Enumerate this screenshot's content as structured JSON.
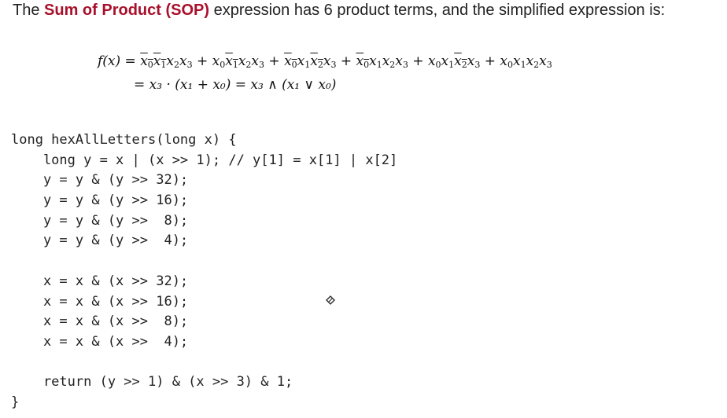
{
  "intro": {
    "before": "The ",
    "highlight": "Sum of Product (SOP)",
    "after": " expression has 6 product terms, and the simplified expression is:"
  },
  "formula": {
    "lhs": "f(x) = ",
    "terms": [
      [
        {
          "v": "x",
          "s": "0",
          "bar": true
        },
        {
          "v": "x",
          "s": "1",
          "bar": true
        },
        {
          "v": "x",
          "s": "2",
          "bar": false
        },
        {
          "v": "x",
          "s": "3",
          "bar": false
        }
      ],
      [
        {
          "v": "x",
          "s": "0",
          "bar": false
        },
        {
          "v": "x",
          "s": "1",
          "bar": true
        },
        {
          "v": "x",
          "s": "2",
          "bar": false
        },
        {
          "v": "x",
          "s": "3",
          "bar": false
        }
      ],
      [
        {
          "v": "x",
          "s": "0",
          "bar": true
        },
        {
          "v": "x",
          "s": "1",
          "bar": false
        },
        {
          "v": "x",
          "s": "2",
          "bar": true
        },
        {
          "v": "x",
          "s": "3",
          "bar": false
        }
      ],
      [
        {
          "v": "x",
          "s": "0",
          "bar": true
        },
        {
          "v": "x",
          "s": "1",
          "bar": false
        },
        {
          "v": "x",
          "s": "2",
          "bar": false
        },
        {
          "v": "x",
          "s": "3",
          "bar": false
        }
      ],
      [
        {
          "v": "x",
          "s": "0",
          "bar": false
        },
        {
          "v": "x",
          "s": "1",
          "bar": false
        },
        {
          "v": "x",
          "s": "2",
          "bar": true
        },
        {
          "v": "x",
          "s": "3",
          "bar": false
        }
      ],
      [
        {
          "v": "x",
          "s": "0",
          "bar": false
        },
        {
          "v": "x",
          "s": "1",
          "bar": false
        },
        {
          "v": "x",
          "s": "2",
          "bar": false
        },
        {
          "v": "x",
          "s": "3",
          "bar": false
        }
      ]
    ],
    "line2": "= x₃ · (x₁ + x₀) = x₃ ∧ (x₁ ∨ x₀)"
  },
  "code": {
    "lines": [
      "long hexAllLetters(long x) {",
      "    long y = x | (x >> 1); // y[1] = x[1] | x[2]",
      "    y = y & (y >> 32);",
      "    y = y & (y >> 16);",
      "    y = y & (y >>  8);",
      "    y = y & (y >>  4);",
      "",
      "    x = x & (x >> 32);",
      "    x = x & (x >> 16);",
      "    x = x & (x >>  8);",
      "    x = x & (x >>  4);",
      "",
      "    return (y >> 1) & (x >> 3) & 1;",
      "}"
    ]
  },
  "cursor": {
    "icon": "eraser-cursor-icon"
  }
}
